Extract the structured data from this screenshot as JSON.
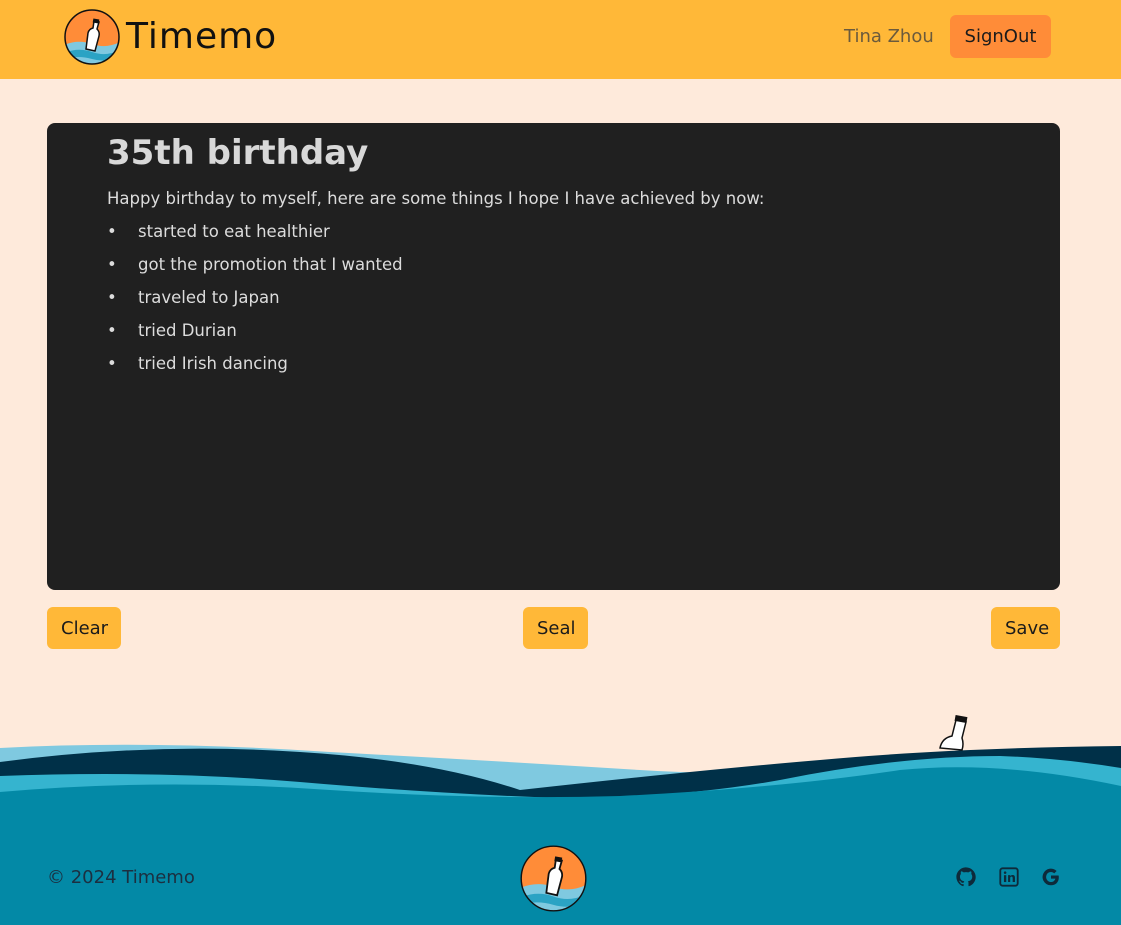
{
  "header": {
    "brand": "Timemo",
    "user_name": "Tina Zhou",
    "signout_label": "SignOut"
  },
  "editor": {
    "title": "35th birthday",
    "intro": "Happy birthday to myself, here are some things I hope I have achieved by now:",
    "items": [
      "started to eat healthier",
      "got the promotion that I wanted",
      "traveled to Japan",
      "tried Durian",
      "tried Irish dancing"
    ]
  },
  "actions": {
    "clear_label": "Clear",
    "seal_label": "Seal",
    "save_label": "Save"
  },
  "footer": {
    "copyright": "© 2024 Timemo",
    "social_icons": [
      "github-icon",
      "linkedin-icon",
      "google-icon"
    ]
  },
  "colors": {
    "header_bg": "#FFB838",
    "page_bg": "#FEEADB",
    "signout_bg": "#FF8C38",
    "editor_bg": "#202020",
    "ocean": "#0389A6"
  }
}
